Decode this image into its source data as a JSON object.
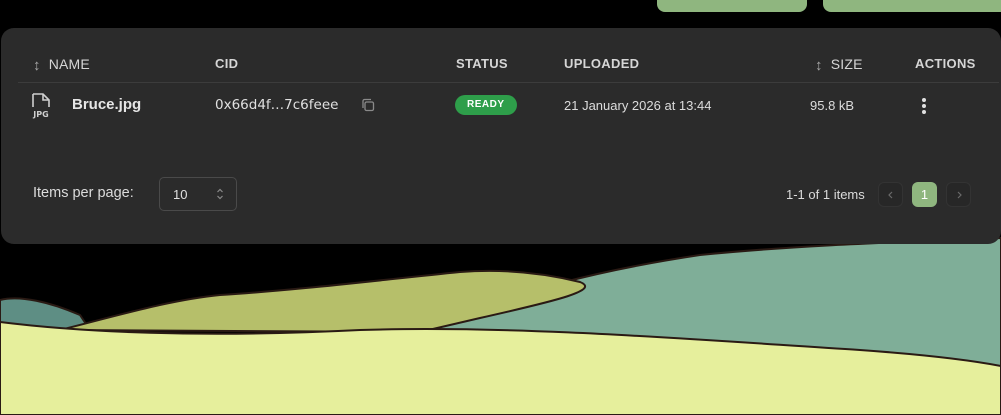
{
  "table": {
    "columns": {
      "name": "NAME",
      "cid": "CID",
      "status": "STATUS",
      "uploaded": "UPLOADED",
      "size": "SIZE",
      "actions": "ACTIONS"
    },
    "rows": [
      {
        "file_type": "JPG",
        "name": "Bruce.jpg",
        "cid": "0x66d4f…7c6feee",
        "status": "READY",
        "uploaded": "21 January 2026 at 13:44",
        "size": "95.8 kB"
      }
    ]
  },
  "pagination": {
    "items_per_page_label": "Items per page:",
    "items_per_page_value": "10",
    "range_text": "1-1 of 1 items",
    "current_page": "1"
  },
  "colors": {
    "accent": "#8fb67f",
    "panel": "#2b2b2b",
    "status_ready": "#2e9e4a"
  },
  "icons": {
    "sort": "sort-arrows-icon",
    "file": "jpg-file-icon",
    "copy": "copy-icon",
    "actions": "kebab-menu-icon",
    "select": "updown-chevron-icon",
    "prev": "chevron-left-icon",
    "next": "chevron-right-icon"
  }
}
